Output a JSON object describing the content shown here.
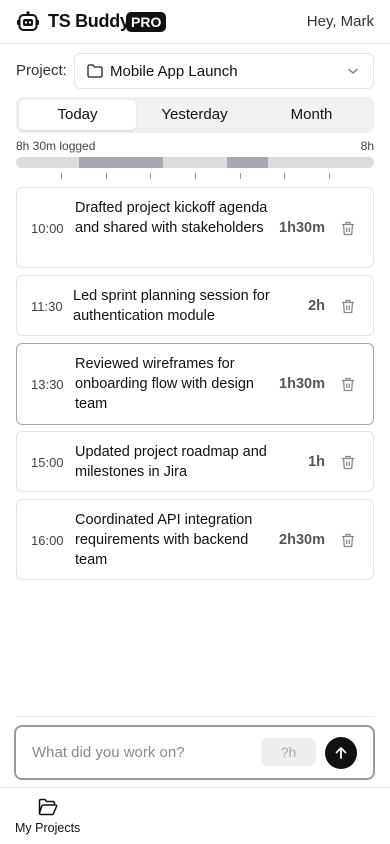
{
  "header": {
    "brand": "TS Buddy",
    "badge": "PRO",
    "greeting": "Hey, Mark",
    "logo_icon": "robot-icon"
  },
  "project": {
    "label": "Project:",
    "selected": "Mobile App Launch",
    "icon": "folder-icon"
  },
  "tabs": [
    {
      "label": "Today",
      "active": true
    },
    {
      "label": "Yesterday",
      "active": false
    },
    {
      "label": "Month",
      "active": false
    }
  ],
  "timeline": {
    "logged_label": "8h 30m logged",
    "max_label": "8h",
    "logged_hours": 8.5,
    "max_hours": 8,
    "bar_color": "#dcdcdf",
    "segment_color": "#a8a8b0"
  },
  "entries": [
    {
      "time": "10:00",
      "text": "Drafted project kickoff agenda and shared with stakeholders",
      "duration": "1h30m"
    },
    {
      "time": "11:30",
      "text": "Led sprint planning session for authentication module",
      "duration": "2h"
    },
    {
      "time": "13:30",
      "text": "Reviewed wireframes for onboarding flow with design team",
      "duration": "1h30m"
    },
    {
      "time": "15:00",
      "text": "Updated project roadmap and milestones in Jira",
      "duration": "1h"
    },
    {
      "time": "16:00",
      "text": "Coordinated API integration requirements with backend team",
      "duration": "2h30m"
    }
  ],
  "composer": {
    "placeholder": "What did you work on?",
    "hours_placeholder": "?h",
    "send_icon": "arrow-up-icon"
  },
  "bottom_nav": {
    "items": [
      {
        "label": "My Projects",
        "icon": "folder-open-icon"
      }
    ]
  }
}
